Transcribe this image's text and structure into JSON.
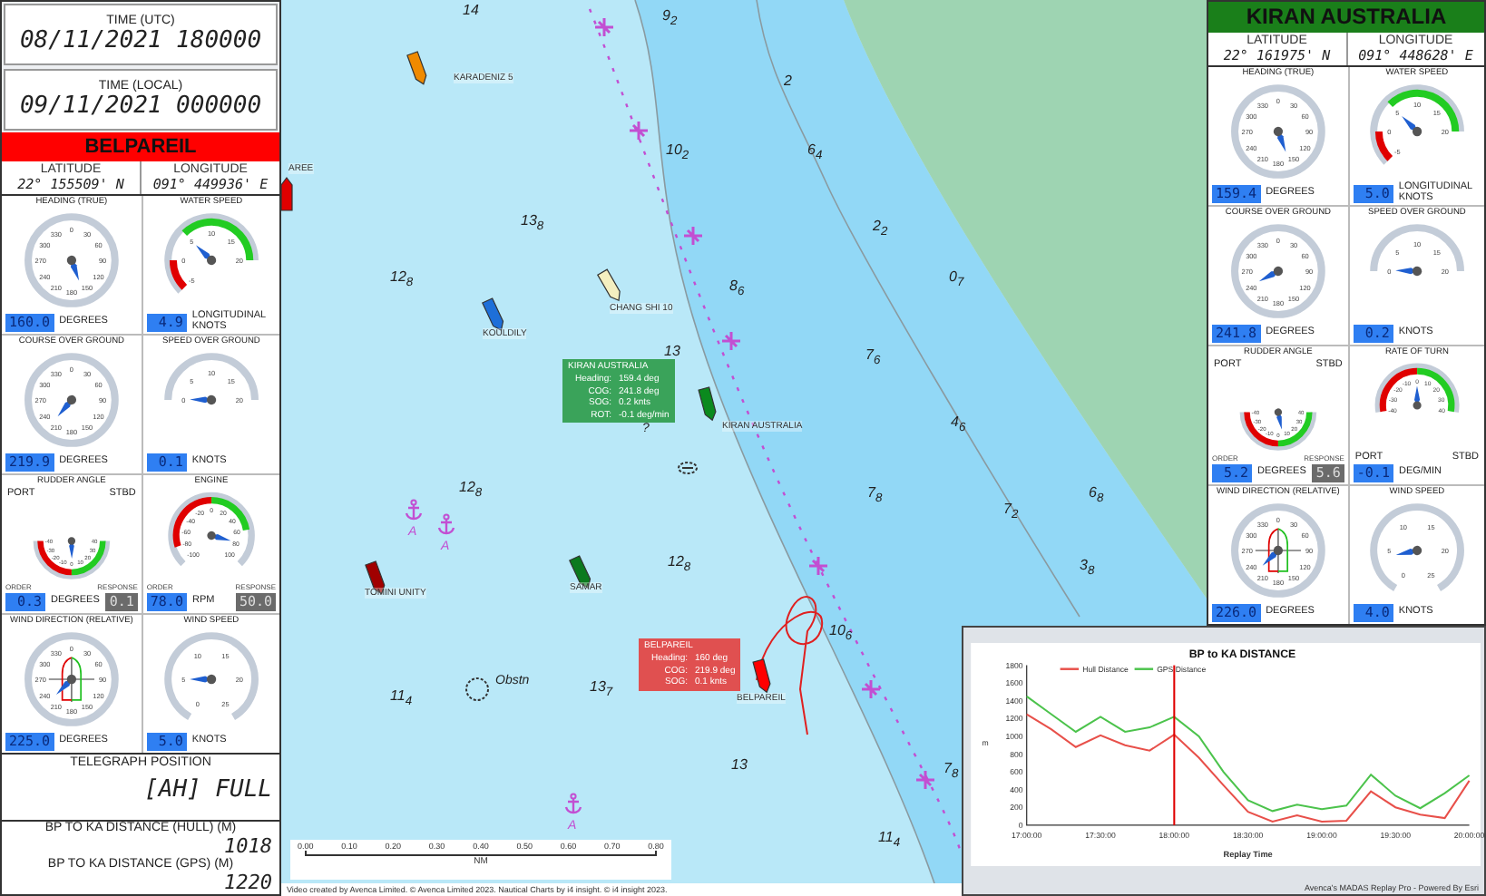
{
  "left_panel": {
    "time_utc": {
      "label": "TIME (UTC)",
      "value": "08/11/2021 180000"
    },
    "time_local": {
      "label": "TIME (LOCAL)",
      "value": "09/11/2021 000000"
    },
    "vessel": {
      "name": "BELPAREIL",
      "color": "#ff0000"
    },
    "position": {
      "latitude_label": "LATITUDE",
      "latitude": "22° 155509' N",
      "longitude_label": "LONGITUDE",
      "longitude": "091° 449936' E"
    },
    "gauges": [
      {
        "title": "HEADING (TRUE)",
        "kind": "compass",
        "ticks": [
          "0",
          "30",
          "60",
          "90",
          "120",
          "150",
          "180",
          "210",
          "240",
          "270",
          "300",
          "330"
        ],
        "readout": "160.0",
        "unit": "DEGREES"
      },
      {
        "title": "WATER SPEED",
        "kind": "speed",
        "ticks": [
          "-5",
          "0",
          "5",
          "10",
          "15",
          "20"
        ],
        "readout": "4.9",
        "unit": "LONGITUDINAL KNOTS"
      },
      {
        "title": "COURSE OVER GROUND",
        "kind": "compass",
        "ticks": [
          "0",
          "30",
          "60",
          "90",
          "120",
          "150",
          "180",
          "210",
          "240",
          "270",
          "300",
          "330"
        ],
        "readout": "219.9",
        "unit": "DEGREES"
      },
      {
        "title": "SPEED OVER GROUND",
        "kind": "sog",
        "ticks": [
          "0",
          "5",
          "10",
          "15",
          "20"
        ],
        "readout": "0.1",
        "unit": "KNOTS"
      },
      {
        "title": "RUDDER ANGLE",
        "kind": "rudder",
        "ticks": [
          "-40",
          "-30",
          "-20",
          "-10",
          "0",
          "10",
          "20",
          "30",
          "40"
        ],
        "side_labels": [
          "PORT",
          "STBD"
        ],
        "order_label": "ORDER",
        "readout": "0.3",
        "unit": "DEGREES",
        "response_label": "RESPONSE",
        "response": "0.1"
      },
      {
        "title": "ENGINE",
        "kind": "engine",
        "ticks": [
          "-100",
          "-80",
          "-60",
          "-40",
          "-20",
          "0",
          "20",
          "40",
          "60",
          "80",
          "100"
        ],
        "order_label": "ORDER",
        "readout": "78.0",
        "unit": "RPM",
        "response_label": "RESPONSE",
        "response": "50.0"
      },
      {
        "title": "WIND DIRECTION (RELATIVE)",
        "kind": "wind_dir",
        "ticks": [
          "0",
          "30",
          "60",
          "90",
          "120",
          "150",
          "180",
          "210",
          "240",
          "270",
          "300",
          "330"
        ],
        "readout": "225.0",
        "unit": "DEGREES"
      },
      {
        "title": "WIND SPEED",
        "kind": "wind_speed",
        "ticks": [
          "0",
          "5",
          "10",
          "15",
          "20",
          "25"
        ],
        "readout": "5.0",
        "unit": "KNOTS"
      }
    ],
    "telegraph": {
      "label": "TELEGRAPH POSITION",
      "value": "[AH] FULL"
    },
    "distances": [
      {
        "label": "BP TO KA DISTANCE (HULL) (M)",
        "value": "1018"
      },
      {
        "label": "BP TO KA DISTANCE (GPS) (M)",
        "value": "1220"
      }
    ]
  },
  "map": {
    "ships": [
      {
        "name": "AREE",
        "color": "#e00000"
      },
      {
        "name": "KARADENIZ 5",
        "color": "#f08a00"
      },
      {
        "name": "CHANG SHI 10",
        "color": "#f4efc0"
      },
      {
        "name": "KOULDILY",
        "color": "#1e6fd9"
      },
      {
        "name": "KIRAN AUSTRALIA",
        "color": "#0b8a1e"
      },
      {
        "name": "TOMINI UNITY",
        "color": "#a00000"
      },
      {
        "name": "SAMAR",
        "color": "#0b7a1e"
      },
      {
        "name": "BELPAREIL",
        "color": "#ff0000"
      }
    ],
    "depths": [
      "14",
      "9$_{2}$",
      "2",
      "6$_{4}$",
      "2$_{2}$",
      "0$_{7}$",
      "10$_{2}$",
      "13$_{8}$",
      "12$_{8}$",
      "8$_{6}$",
      "13",
      "7$_{6}$",
      "4$_{6}$",
      "12$_{8}$",
      "12$_{8}$",
      "7$_{8}$",
      "11$_{4}$",
      "13$_{7}$",
      "10$_{6}$",
      "13",
      "7$_{8}$",
      "11$_{4}$",
      "7$_{2}$",
      "3$_{8}$",
      "6$_{8}$"
    ],
    "labels": [
      "Obstn",
      "?"
    ],
    "anchorages": [
      "A",
      "A",
      "A"
    ],
    "tooltips": [
      {
        "title": "KIRAN AUSTRALIA",
        "color": "#3aa35a",
        "rows": [
          {
            "label": "Heading:",
            "value": "159.4 deg"
          },
          {
            "label": "COG:",
            "value": "241.8 deg"
          },
          {
            "label": "SOG:",
            "value": "0.2 knts"
          },
          {
            "label": "ROT:",
            "value": "-0.1 deg/min"
          }
        ]
      },
      {
        "title": "BELPAREIL",
        "color": "#e05050",
        "rows": [
          {
            "label": "Heading:",
            "value": "160 deg"
          },
          {
            "label": "COG:",
            "value": "219.9 deg"
          },
          {
            "label": "SOG:",
            "value": "0.1 knts"
          }
        ]
      }
    ],
    "scale": {
      "ticks": [
        "0.00",
        "0.10",
        "0.20",
        "0.30",
        "0.40",
        "0.50",
        "0.60",
        "0.70",
        "0.80"
      ],
      "unit": "NM"
    },
    "credit": "Video created by Avenca Limited. © Avenca Limited 2023. Nautical Charts by i4 insight. © i4 insight 2023."
  },
  "right_panel": {
    "vessel": {
      "name": "KIRAN AUSTRALIA",
      "color": "#1a7f1a"
    },
    "position": {
      "latitude_label": "LATITUDE",
      "latitude": "22° 161975' N",
      "longitude_label": "LONGITUDE",
      "longitude": "091° 448628' E"
    },
    "gauges": [
      {
        "title": "HEADING (TRUE)",
        "kind": "compass",
        "ticks": [
          "0",
          "30",
          "60",
          "90",
          "120",
          "150",
          "180",
          "210",
          "240",
          "270",
          "300",
          "330"
        ],
        "readout": "159.4",
        "unit": "DEGREES"
      },
      {
        "title": "WATER SPEED",
        "kind": "speed",
        "ticks": [
          "-5",
          "0",
          "5",
          "10",
          "15",
          "20"
        ],
        "readout": "5.0",
        "unit": "LONGITUDINAL KNOTS"
      },
      {
        "title": "COURSE OVER GROUND",
        "kind": "compass",
        "ticks": [
          "0",
          "30",
          "60",
          "90",
          "120",
          "150",
          "180",
          "210",
          "240",
          "270",
          "300",
          "330"
        ],
        "readout": "241.8",
        "unit": "DEGREES"
      },
      {
        "title": "SPEED OVER GROUND",
        "kind": "sog",
        "ticks": [
          "0",
          "5",
          "10",
          "15",
          "20"
        ],
        "readout": "0.2",
        "unit": "KNOTS"
      },
      {
        "title": "RUDDER ANGLE",
        "kind": "rudder",
        "ticks": [
          "-40",
          "-30",
          "-20",
          "-10",
          "0",
          "10",
          "20",
          "30",
          "40"
        ],
        "side_labels": [
          "PORT",
          "STBD"
        ],
        "order_label": "ORDER",
        "readout": "5.2",
        "unit": "DEGREES",
        "response_label": "RESPONSE",
        "response": "5.6"
      },
      {
        "title": "RATE OF TURN",
        "kind": "rot",
        "ticks": [
          "-40",
          "-30",
          "-20",
          "-10",
          "0",
          "10",
          "20",
          "30",
          "40"
        ],
        "side_labels": [
          "PORT",
          "STBD"
        ],
        "readout": "-0.1",
        "unit": "DEG/MIN"
      },
      {
        "title": "WIND DIRECTION (RELATIVE)",
        "kind": "wind_dir",
        "ticks": [
          "0",
          "30",
          "60",
          "90",
          "120",
          "150",
          "180",
          "210",
          "240",
          "270",
          "300",
          "330"
        ],
        "readout": "226.0",
        "unit": "DEGREES"
      },
      {
        "title": "WIND SPEED",
        "kind": "wind_speed",
        "ticks": [
          "0",
          "5",
          "10",
          "15",
          "20",
          "25"
        ],
        "readout": "4.0",
        "unit": "KNOTS"
      }
    ]
  },
  "chart_panel": {
    "chart_data": {
      "type": "line",
      "title": "BP to KA DISTANCE",
      "xlabel": "Replay Time",
      "ylabel": "m",
      "categories": [
        "17:00:00",
        null,
        null,
        "17:30:00",
        null,
        null,
        "18:00:00",
        null,
        null,
        "18:30:00",
        null,
        null,
        "19:00:00",
        null,
        null,
        "19:30:00",
        null,
        null,
        "20:00:00"
      ],
      "series": [
        {
          "name": "Hull Distance",
          "color": "#e8504a",
          "values": [
            1250,
            1080,
            880,
            1010,
            900,
            840,
            1020,
            760,
            450,
            150,
            40,
            110,
            40,
            50,
            380,
            200,
            120,
            80,
            500
          ]
        },
        {
          "name": "GPS Distance",
          "color": "#4cc34c",
          "values": [
            1450,
            1250,
            1050,
            1220,
            1050,
            1100,
            1220,
            1000,
            600,
            280,
            160,
            230,
            180,
            220,
            570,
            330,
            190,
            360,
            560
          ]
        }
      ],
      "ylim": [
        0,
        1800
      ],
      "legend": "upper left",
      "yticks": [
        0,
        200,
        400,
        600,
        800,
        1000,
        1200,
        1400,
        1600,
        1800
      ],
      "annotations": [
        {
          "x": "18:00:00"
        }
      ]
    },
    "credit": "Avenca's MADAS Replay Pro - Powered By Esri"
  }
}
